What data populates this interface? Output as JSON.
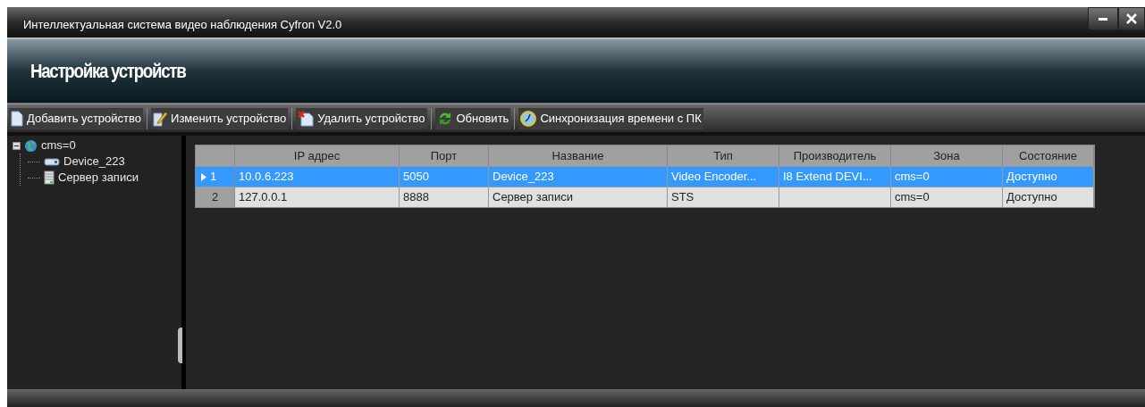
{
  "window": {
    "title": "Интеллектуальная система видео наблюдения Cyfron V2.0"
  },
  "header": {
    "title": "Настройка устройств"
  },
  "toolbar": [
    {
      "kind": "add",
      "label": "Добавить устройство"
    },
    {
      "kind": "edit",
      "label": "Изменить устройство"
    },
    {
      "kind": "delete",
      "label": "Удалить устройство"
    },
    {
      "kind": "refresh",
      "label": "Обновить"
    },
    {
      "kind": "sync",
      "label": "Синхронизация времени с ПК"
    }
  ],
  "tree": [
    {
      "kind": "zone",
      "label": "cms=0",
      "expanded": true,
      "children": [
        {
          "kind": "device",
          "label": "Device_223"
        },
        {
          "kind": "server",
          "label": "Сервер записи"
        }
      ]
    }
  ],
  "table": {
    "columns": [
      "IP адрес",
      "Порт",
      "Название",
      "Тип",
      "Производитель",
      "Зона",
      "Состояние"
    ],
    "rows": [
      {
        "number": "1",
        "selected": true,
        "cells": [
          "10.0.6.223",
          "5050",
          "Device_223",
          "Video Encoder...",
          "I8 Extend DEVI...",
          "cms=0",
          "Доступно"
        ]
      },
      {
        "number": "2",
        "selected": false,
        "cells": [
          "127.0.0.1",
          "8888",
          "Сервер записи",
          "STS",
          "",
          "cms=0",
          "Доступно"
        ]
      }
    ]
  }
}
